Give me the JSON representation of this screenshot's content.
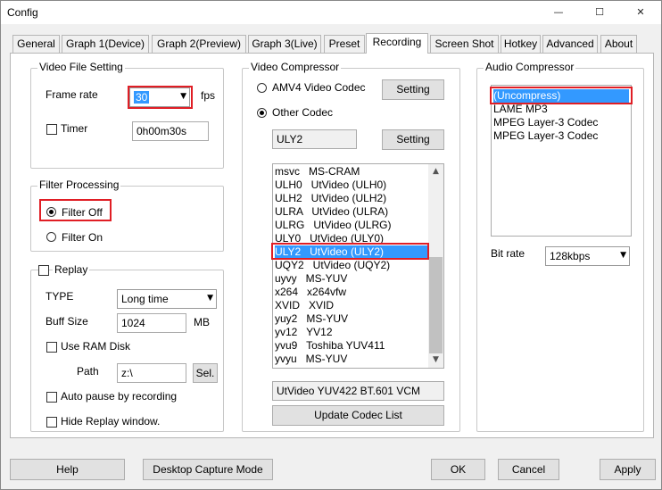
{
  "window": {
    "title": "Config",
    "minimize_glyph": "—",
    "maximize_glyph": "☐",
    "close_glyph": "✕"
  },
  "tabs": [
    "General",
    "Graph 1(Device)",
    "Graph 2(Preview)",
    "Graph 3(Live)",
    "Preset",
    "Recording",
    "Screen Shot",
    "Hotkey",
    "Advanced",
    "About"
  ],
  "active_tab": "Recording",
  "video_file": {
    "title": "Video File Setting",
    "frame_rate_label": "Frame rate",
    "frame_rate_value": "30",
    "fps_label": "fps",
    "timer_label": "Timer",
    "timer_value": "0h00m30s"
  },
  "filter": {
    "title": "Filter Processing",
    "off_label": "Filter Off",
    "on_label": "Filter On"
  },
  "replay": {
    "label": "Replay",
    "type_label": "TYPE",
    "type_value": "Long time",
    "buff_label": "Buff Size",
    "buff_value": "1024",
    "buff_unit": "MB",
    "ram_label": "Use RAM Disk",
    "path_label": "Path",
    "path_value": "z:\\",
    "sel_label": "Sel.",
    "auto_pause_label": "Auto pause by recording",
    "hide_label": "Hide Replay window."
  },
  "video_compressor": {
    "title": "Video Compressor",
    "amv4_label": "AMV4 Video Codec",
    "other_label": "Other Codec",
    "setting_label": "Setting",
    "current_codec": "ULY2",
    "codecs": [
      "msvc   MS-CRAM",
      "ULH0   UtVideo (ULH0)",
      "ULH2   UtVideo (ULH2)",
      "ULRA   UtVideo (ULRA)",
      "ULRG   UtVideo (ULRG)",
      "ULY0   UtVideo (ULY0)",
      "ULY2   UtVideo (ULY2)",
      "UQY2   UtVideo (UQY2)",
      "uyvy   MS-YUV",
      "x264   x264vfw",
      "XVID   XVID",
      "yuy2   MS-YUV",
      "yv12   YV12",
      "yvu9   Toshiba YUV411",
      "yvyu   MS-YUV"
    ],
    "selected_index": 6,
    "codec_description": "UtVideo YUV422 BT.601 VCM",
    "update_label": "Update Codec List"
  },
  "audio_compressor": {
    "title": "Audio Compressor",
    "items": [
      "(Uncompress)",
      "LAME MP3",
      "MPEG Layer-3 Codec",
      "MPEG Layer-3 Codec"
    ],
    "selected_index": 0,
    "bitrate_label": "Bit rate",
    "bitrate_value": "128kbps"
  },
  "bottom": {
    "help": "Help",
    "desktop": "Desktop Capture Mode",
    "ok": "OK",
    "cancel": "Cancel",
    "apply": "Apply"
  },
  "colors": {
    "highlight": "#3399ff",
    "annotation": "#e01e25"
  }
}
